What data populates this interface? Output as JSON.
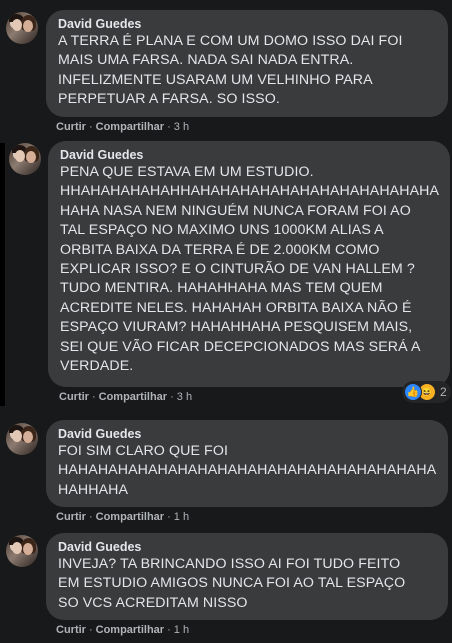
{
  "comments": [
    {
      "author": "David Guedes",
      "text": "A TERRA É PLANA E COM UM DOMO ISSO DAI FOI\nMAIS UMA FARSA. NADA SAI NADA ENTRA.\nINFELIZMENTE USARAM UM VELHINHO PARA\nPERPETUAR A FARSA. SO ISSO.",
      "like": "Curtir",
      "share": "Compartilhar",
      "time": "3 h"
    },
    {
      "author": "David Guedes",
      "text": "PENA QUE ESTAVA EM UM ESTUDIO.\nHHAHAHAHAHAHHAHAHAHAHAHAHAHAHAHAHAHAHA\nHAHA NASA NEM NINGUÉM NUNCA FORAM FOI AO\nTAL ESPAÇO NO MAXIMO UNS 1000KM ALIAS A\nORBITA BAIXA DA TERRA É DE 2.000KM COMO\nEXPLICAR ISSO? E O CINTURÃO DE VAN HALLEM ?\nTUDO MENTIRA. HAHAHHAHA MAS TEM QUEM\nACREDITE NELES. HAHAHAH ORBITA BAIXA NÃO É\nESPAÇO VIURAM? HAHAHHAHA PESQUISEM MAIS,\nSEI QUE VÃO FICAR DECEPCIONADOS MAS SERÁ A\nVERDADE.",
      "like": "Curtir",
      "share": "Compartilhar",
      "time": "3 h",
      "reaction_count": "2"
    },
    {
      "author": "David Guedes",
      "text": "FOI SIM CLARO QUE FOI\nHAHAHAHAHAHAHAHAHAHAHAHAHAHAHAHAHAHAHA\nHAHHAHA",
      "like": "Curtir",
      "share": "Compartilhar",
      "time": "1 h"
    },
    {
      "author": "David Guedes",
      "text": "INVEJA? TA BRINCANDO ISSO AI FOI TUDO FEITO\nEM ESTUDIO AMIGOS NUNCA FOI AO TAL ESPAÇO\nSO VCS ACREDITAM NISSO",
      "like": "Curtir",
      "share": "Compartilhar",
      "time": "1 h"
    }
  ],
  "colors": {
    "background": "#18191a",
    "bubble": "#3a3b3c",
    "text": "#e4e6eb",
    "meta": "#b0b3b8",
    "like_blue": "#2d88ff",
    "haha_yellow": "#f7b125"
  },
  "icons": [
    "avatar",
    "like-reaction-icon",
    "haha-reaction-icon"
  ]
}
